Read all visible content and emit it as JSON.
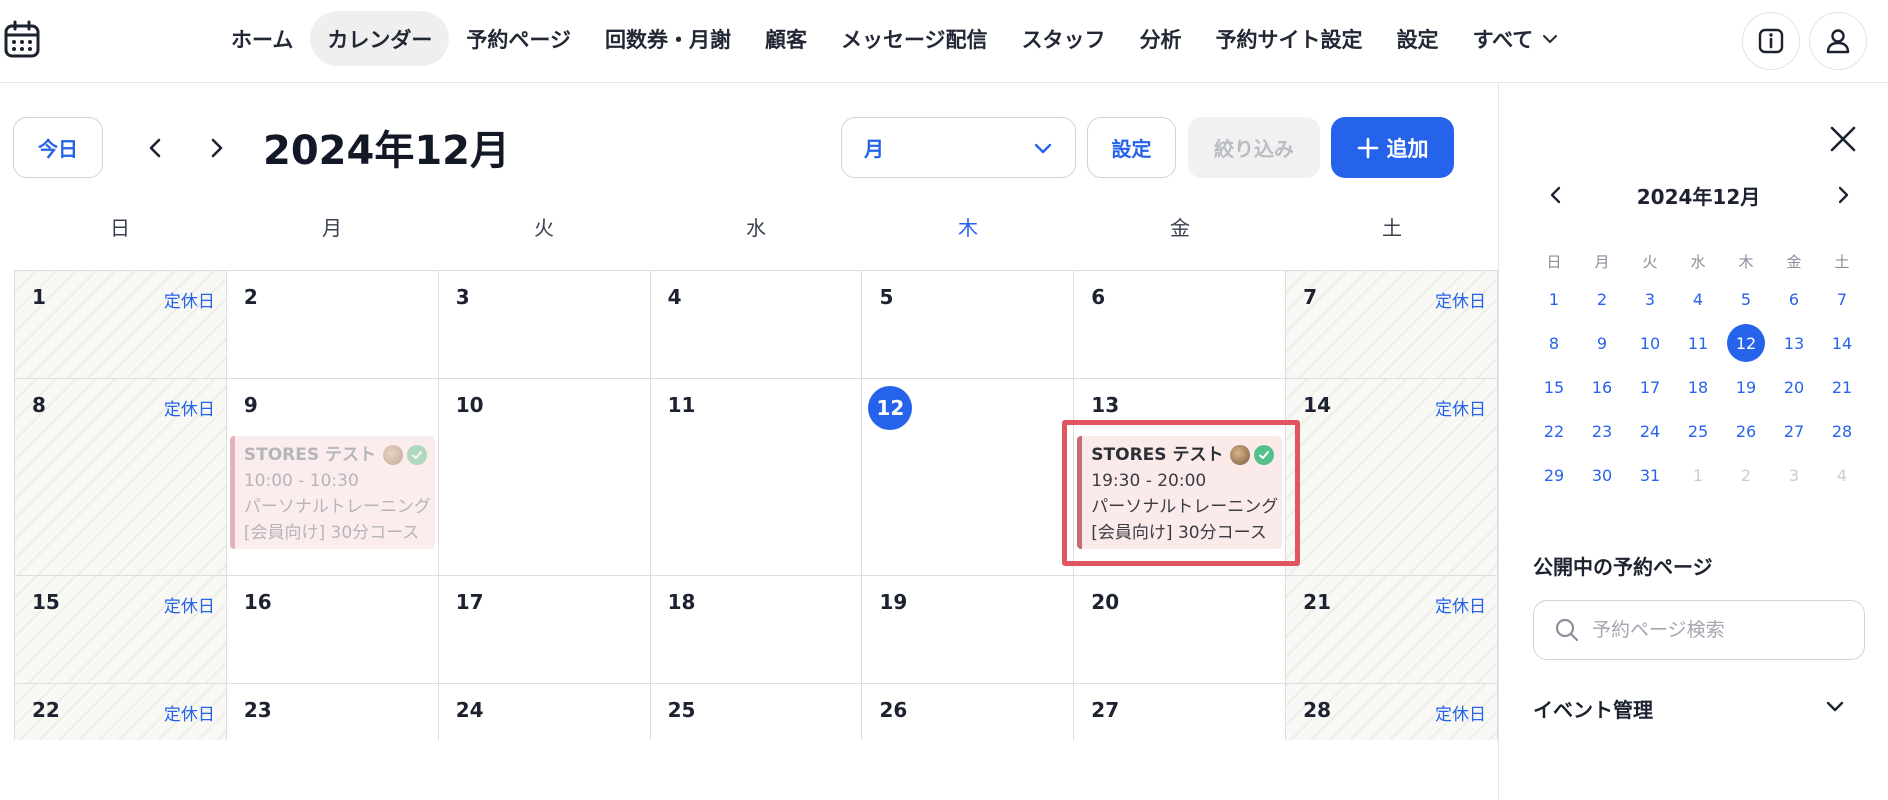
{
  "nav": {
    "items": [
      {
        "label": "ホーム",
        "active": false
      },
      {
        "label": "カレンダー",
        "active": true
      },
      {
        "label": "予約ページ",
        "active": false
      },
      {
        "label": "回数券・月謝",
        "active": false
      },
      {
        "label": "顧客",
        "active": false
      },
      {
        "label": "メッセージ配信",
        "active": false
      },
      {
        "label": "スタッフ",
        "active": false
      },
      {
        "label": "分析",
        "active": false
      },
      {
        "label": "予約サイト設定",
        "active": false
      },
      {
        "label": "設定",
        "active": false
      }
    ],
    "more_label": "すべて",
    "icons": [
      "calendar-icon",
      "info-icon",
      "user-icon",
      "chevron-down-icon"
    ]
  },
  "toolbar": {
    "today_label": "今日",
    "title": "2024年12月",
    "view_value": "月",
    "settings_label": "設定",
    "filter_label": "絞り込み",
    "add_label": "追加"
  },
  "calendar": {
    "weekdays": [
      "日",
      "月",
      "火",
      "水",
      "木",
      "金",
      "土"
    ],
    "highlight_weekday": "木",
    "holiday_label": "定休日",
    "today": "12",
    "weeks": [
      [
        "1",
        "2",
        "3",
        "4",
        "5",
        "6",
        "7"
      ],
      [
        "8",
        "9",
        "10",
        "11",
        "12",
        "13",
        "14"
      ],
      [
        "15",
        "16",
        "17",
        "18",
        "19",
        "20",
        "21"
      ],
      [
        "22",
        "23",
        "24",
        "25",
        "26",
        "27",
        "28"
      ]
    ],
    "events": [
      {
        "day": "9",
        "title": "STORES テスト",
        "time": "10:00 - 10:30",
        "menu": "パーソナルトレーニング",
        "course": "[会員向け] 30分コース",
        "faded": true,
        "selected": false
      },
      {
        "day": "13",
        "title": "STORES テスト",
        "time": "19:30 - 20:00",
        "menu": "パーソナルトレーニング",
        "course": "[会員向け] 30分コース",
        "faded": false,
        "selected": true
      }
    ]
  },
  "sidebar": {
    "mini_title": "2024年12月",
    "mini_weekdays": [
      "日",
      "月",
      "火",
      "水",
      "木",
      "金",
      "土"
    ],
    "mini_weeks": [
      [
        "1",
        "2",
        "3",
        "4",
        "5",
        "6",
        "7"
      ],
      [
        "8",
        "9",
        "10",
        "11",
        "12",
        "13",
        "14"
      ],
      [
        "15",
        "16",
        "17",
        "18",
        "19",
        "20",
        "21"
      ],
      [
        "22",
        "23",
        "24",
        "25",
        "26",
        "27",
        "28"
      ],
      [
        "29",
        "30",
        "31",
        "1",
        "2",
        "3",
        "4"
      ]
    ],
    "public_pages_title": "公開中の予約ページ",
    "search_placeholder": "予約ページ検索",
    "event_mgmt_title": "イベント管理"
  },
  "colors": {
    "accent": "#2563eb",
    "event_bg": "#fbeaea",
    "selection": "#e0555f",
    "confirmed": "#56c08b"
  }
}
